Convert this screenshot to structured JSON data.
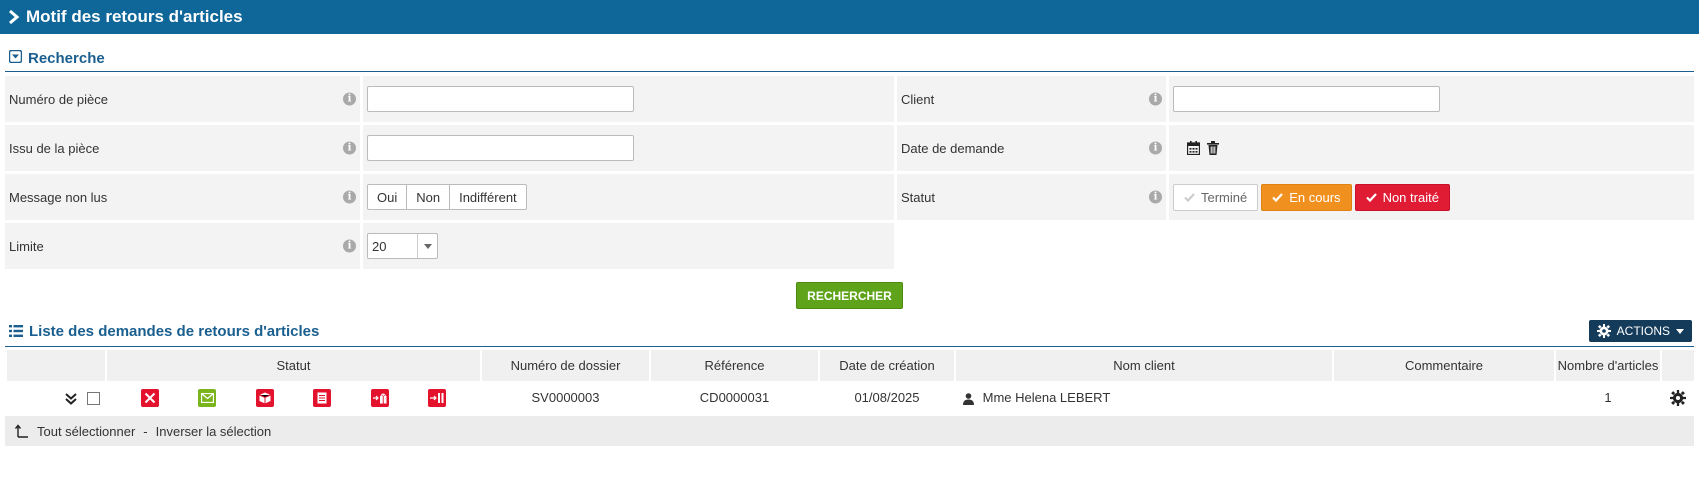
{
  "header": {
    "title": "Motif des retours d'articles"
  },
  "search": {
    "title": "Recherche",
    "fields": {
      "piece_label": "Numéro de pièce",
      "piece_value": "",
      "client_label": "Client",
      "client_value": "",
      "issu_label": "Issu de la pièce",
      "issu_value": "",
      "date_label": "Date de demande",
      "message_label": "Message non lus",
      "message_options": [
        "Oui",
        "Non",
        "Indifférent"
      ],
      "statut_label": "Statut",
      "statut_options": [
        "Terminé",
        "En cours",
        "Non traité"
      ],
      "limite_label": "Limite",
      "limite_value": "20"
    },
    "button": "RECHERCHER"
  },
  "list": {
    "title": "Liste des demandes de retours d'articles",
    "actions_label": "ACTIONS",
    "columns": [
      "",
      "Statut",
      "Numéro de dossier",
      "Référence",
      "Date de création",
      "Nom client",
      "Commentaire",
      "Nombre d'articles",
      ""
    ],
    "rows": [
      {
        "dossier": "SV0000003",
        "reference": "CD0000031",
        "date": "01/08/2025",
        "client": "Mme Helena LEBERT",
        "commentaire": "",
        "nombre": "1"
      }
    ],
    "select_all": "Tout sélectionner",
    "separator": "-",
    "invert": "Inverser la sélection"
  },
  "colors": {
    "header_bg": "#0e6699",
    "accent": "#1a5f8f",
    "search_btn": "#5ea31a",
    "status_en_cours": "#f0901e",
    "status_non_traite": "#e01b34",
    "icon_red": "#e3132d",
    "icon_green": "#7ab51d",
    "actions_btn": "#153b5a"
  },
  "icons": {
    "header": "chevron-right-icon",
    "search_section": "collapse-square-icon",
    "list_section": "list-icon",
    "date_calendar": "calendar-icon",
    "date_clear": "trash-icon",
    "actions": "gear-icon",
    "row_expand": "double-chevron-down-icon",
    "row_settings": "gear-icon",
    "status_row": [
      "close-icon",
      "envelope-icon",
      "package-icon",
      "document-icon",
      "return-gift-icon",
      "return-barrier-icon"
    ],
    "footer": "arrow-up-corner-icon"
  }
}
